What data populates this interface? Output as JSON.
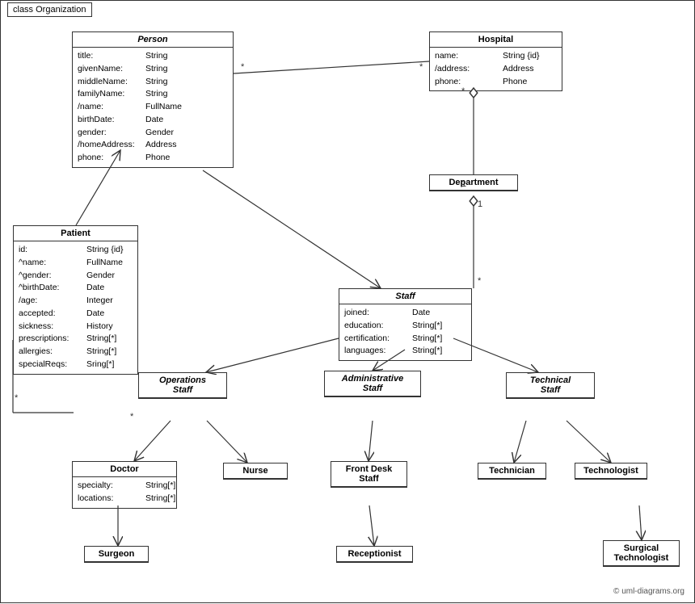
{
  "diagram": {
    "title": "class Organization",
    "classes": {
      "person": {
        "name": "Person",
        "italic": true,
        "attrs": [
          {
            "name": "title:",
            "type": "String"
          },
          {
            "name": "givenName:",
            "type": "String"
          },
          {
            "name": "middleName:",
            "type": "String"
          },
          {
            "name": "familyName:",
            "type": "String"
          },
          {
            "name": "/name:",
            "type": "FullName"
          },
          {
            "name": "birthDate:",
            "type": "Date"
          },
          {
            "name": "gender:",
            "type": "Gender"
          },
          {
            "name": "/homeAddress:",
            "type": "Address"
          },
          {
            "name": "phone:",
            "type": "Phone"
          }
        ]
      },
      "hospital": {
        "name": "Hospital",
        "italic": false,
        "attrs": [
          {
            "name": "name:",
            "type": "String {id}"
          },
          {
            "name": "/address:",
            "type": "Address"
          },
          {
            "name": "phone:",
            "type": "Phone"
          }
        ]
      },
      "department": {
        "name": "Department",
        "italic": false,
        "attrs": []
      },
      "staff": {
        "name": "Staff",
        "italic": true,
        "attrs": [
          {
            "name": "joined:",
            "type": "Date"
          },
          {
            "name": "education:",
            "type": "String[*]"
          },
          {
            "name": "certification:",
            "type": "String[*]"
          },
          {
            "name": "languages:",
            "type": "String[*]"
          }
        ]
      },
      "patient": {
        "name": "Patient",
        "italic": false,
        "attrs": [
          {
            "name": "id:",
            "type": "String {id}"
          },
          {
            "name": "^name:",
            "type": "FullName"
          },
          {
            "name": "^gender:",
            "type": "Gender"
          },
          {
            "name": "^birthDate:",
            "type": "Date"
          },
          {
            "name": "/age:",
            "type": "Integer"
          },
          {
            "name": "accepted:",
            "type": "Date"
          },
          {
            "name": "sickness:",
            "type": "History"
          },
          {
            "name": "prescriptions:",
            "type": "String[*]"
          },
          {
            "name": "allergies:",
            "type": "String[*]"
          },
          {
            "name": "specialReqs:",
            "type": "Sring[*]"
          }
        ]
      },
      "operations_staff": {
        "name": "Operations Staff",
        "italic": true
      },
      "administrative_staff": {
        "name": "Administrative Staff",
        "italic": true
      },
      "technical_staff": {
        "name": "Technical Staff",
        "italic": true
      },
      "doctor": {
        "name": "Doctor",
        "italic": false,
        "attrs": [
          {
            "name": "specialty:",
            "type": "String[*]"
          },
          {
            "name": "locations:",
            "type": "String[*]"
          }
        ]
      },
      "nurse": {
        "name": "Nurse",
        "italic": false
      },
      "front_desk_staff": {
        "name": "Front Desk Staff",
        "italic": false
      },
      "technician": {
        "name": "Technician",
        "italic": false
      },
      "technologist": {
        "name": "Technologist",
        "italic": false
      },
      "surgeon": {
        "name": "Surgeon",
        "italic": false
      },
      "receptionist": {
        "name": "Receptionist",
        "italic": false
      },
      "surgical_technologist": {
        "name": "Surgical Technologist",
        "italic": false
      }
    },
    "copyright": "© uml-diagrams.org"
  }
}
